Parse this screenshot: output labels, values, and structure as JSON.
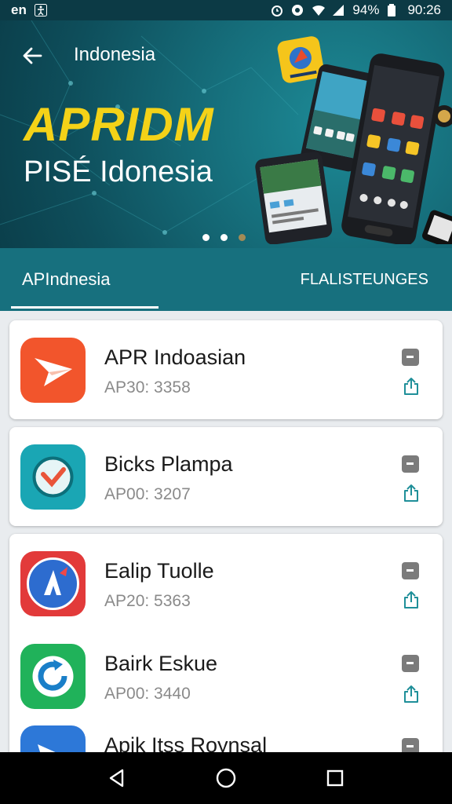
{
  "status_bar": {
    "left_text": "en",
    "battery": "94%",
    "time": "90:26"
  },
  "header": {
    "title": "Indonesia",
    "hero_title": "APRIDM",
    "hero_subtitle": "PISÉ Idonesia"
  },
  "carousel": {
    "count": 3,
    "active_index": 0
  },
  "tabs": [
    {
      "label": "APIndnesia",
      "active": true
    },
    {
      "label": "FLALISTEUNGES",
      "active": false
    }
  ],
  "apps": [
    {
      "name": "APR Indoasian",
      "meta": "AP30: 3358",
      "icon": "paper-plane-icon",
      "color": "#f2552c"
    },
    {
      "name": "Bicks Plampa",
      "meta": "AP00: 3207",
      "icon": "check-badge-icon",
      "color": "#1aa6b4"
    },
    {
      "name": "Ealip Tuolle",
      "meta": "AP20: 5363",
      "icon": "compass-icon",
      "color": "#e23a3a"
    },
    {
      "name": "Bairk Eskue",
      "meta": "AP00: 3440",
      "icon": "refresh-arrow-icon",
      "color": "#20b25a"
    },
    {
      "name": "Apik Itss Roynsal",
      "meta": "",
      "icon": "blue-app-icon",
      "color": "#2d78d8"
    }
  ],
  "colors": {
    "accent": "#17707e",
    "hero_title": "#f4d218",
    "share_icon": "#1f8f99"
  }
}
